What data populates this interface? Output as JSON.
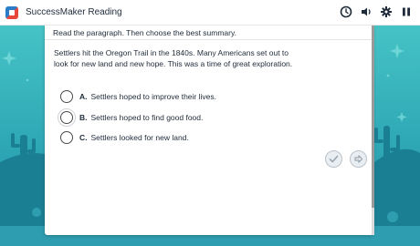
{
  "header": {
    "app_title": "SuccessMaker Reading",
    "tools": [
      {
        "icon": "clock-icon"
      },
      {
        "icon": "speaker-icon"
      },
      {
        "icon": "gear-icon"
      },
      {
        "icon": "pause-icon"
      }
    ]
  },
  "question": {
    "prompt": "Read the paragraph. Then choose the best summary.",
    "passage": "Settlers hit the Oregon Trail in the 1840s. Many Americans set out to look for new land and new hope. This was a time of great exploration.",
    "choices": [
      {
        "letter": "A.",
        "text": "Settlers hoped to improve their lives."
      },
      {
        "letter": "B.",
        "text": "Settlers hoped to find good food."
      },
      {
        "letter": "C.",
        "text": "Settlers looked for new land."
      }
    ]
  },
  "controls": {
    "check_icon": "check-icon",
    "next_icon": "next-arrow-icon"
  },
  "colors": {
    "background_teal": "#2ea7b5",
    "silhouette": "#1b7f93",
    "button_gray": "#b9c2ca"
  }
}
